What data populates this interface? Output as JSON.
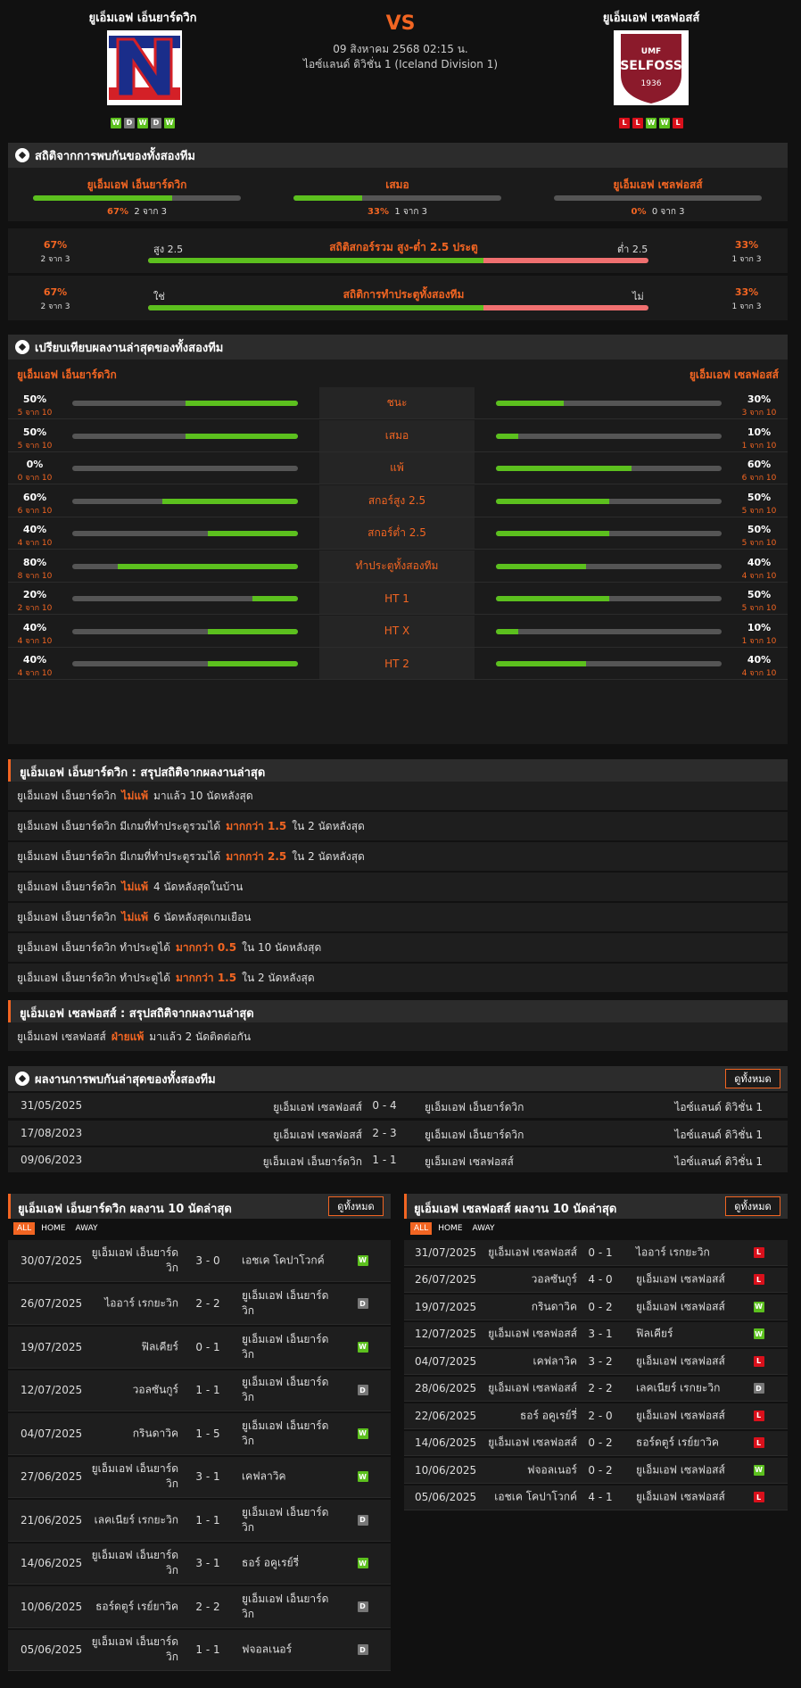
{
  "header": {
    "home_name": "ยูเอ็มเอฟ เอ็นยาร์ดวิก",
    "away_name": "ยูเอ็มเอฟ เซลฟอสส์",
    "vs": "VS",
    "datetime": "09 สิงหาคม 2568 02:15 น.",
    "league": "ไอซ์แลนด์ ดิวิชั่น 1 (Iceland Division 1)",
    "home_form": [
      "W",
      "D",
      "W",
      "D",
      "W"
    ],
    "away_form": [
      "L",
      "L",
      "W",
      "W",
      "L"
    ],
    "away_logo_text": {
      "top": "UMF",
      "main": "SELFOSS",
      "year": "1936"
    },
    "home_logo_letter": "N"
  },
  "h2h_stats": {
    "title": "สถิติจากการพบกันของทั้งสองทีม",
    "home": {
      "label": "ยูเอ็มเอฟ เอ็นยาร์ดวิก",
      "pct": "67%",
      "count": "2 จาก 3",
      "value": 0.67
    },
    "draw": {
      "label": "เสมอ",
      "pct": "33%",
      "count": "1 จาก 3",
      "value": 0.33
    },
    "away": {
      "label": "ยูเอ็มเอฟ เซลฟอสส์",
      "pct": "0%",
      "count": "0 จาก 3",
      "value": 0
    },
    "ou": {
      "left_pct": "67%",
      "left_count": "2 จาก 3",
      "left_label": "สูง 2.5",
      "title": "สถิติสกอร์รวม สูง-ต่ำ 2.5 ประตู",
      "right_label": "ต่ำ 2.5",
      "right_pct": "33%",
      "right_count": "1 จาก 3",
      "value": 0.67
    },
    "btts": {
      "left_pct": "67%",
      "left_count": "2 จาก 3",
      "left_label": "ใช่",
      "title": "สถิติการทำประตูทั้งสองทีม",
      "right_label": "ไม่",
      "right_pct": "33%",
      "right_count": "1 จาก 3",
      "value": 0.67
    }
  },
  "compare": {
    "title": "เปรียบเทียบผลงานล่าสุดของทั้งสองทีม",
    "home_label": "ยูเอ็มเอฟ เอ็นยาร์ดวิก",
    "away_label": "ยูเอ็มเอฟ เซลฟอสส์",
    "rows": [
      {
        "label": "ชนะ",
        "h_pct": "50%",
        "h_cnt": "5 จาก 10",
        "h_val": 0.5,
        "a_pct": "30%",
        "a_cnt": "3 จาก 10",
        "a_val": 0.3
      },
      {
        "label": "เสมอ",
        "h_pct": "50%",
        "h_cnt": "5 จาก 10",
        "h_val": 0.5,
        "a_pct": "10%",
        "a_cnt": "1 จาก 10",
        "a_val": 0.1
      },
      {
        "label": "แพ้",
        "h_pct": "0%",
        "h_cnt": "0 จาก 10",
        "h_val": 0,
        "a_pct": "60%",
        "a_cnt": "6 จาก 10",
        "a_val": 0.6
      },
      {
        "label": "สกอร์สูง 2.5",
        "h_pct": "60%",
        "h_cnt": "6 จาก 10",
        "h_val": 0.6,
        "a_pct": "50%",
        "a_cnt": "5 จาก 10",
        "a_val": 0.5
      },
      {
        "label": "สกอร์ต่ำ 2.5",
        "h_pct": "40%",
        "h_cnt": "4 จาก 10",
        "h_val": 0.4,
        "a_pct": "50%",
        "a_cnt": "5 จาก 10",
        "a_val": 0.5
      },
      {
        "label": "ทำประตูทั้งสองทีม",
        "h_pct": "80%",
        "h_cnt": "8 จาก 10",
        "h_val": 0.8,
        "a_pct": "40%",
        "a_cnt": "4 จาก 10",
        "a_val": 0.4
      },
      {
        "label": "HT 1",
        "h_pct": "20%",
        "h_cnt": "2 จาก 10",
        "h_val": 0.2,
        "a_pct": "50%",
        "a_cnt": "5 จาก 10",
        "a_val": 0.5
      },
      {
        "label": "HT X",
        "h_pct": "40%",
        "h_cnt": "4 จาก 10",
        "h_val": 0.4,
        "a_pct": "10%",
        "a_cnt": "1 จาก 10",
        "a_val": 0.1
      },
      {
        "label": "HT 2",
        "h_pct": "40%",
        "h_cnt": "4 จาก 10",
        "h_val": 0.4,
        "a_pct": "40%",
        "a_cnt": "4 จาก 10",
        "a_val": 0.4
      }
    ]
  },
  "home_summary": {
    "title": "ยูเอ็มเอฟ เอ็นยาร์ดวิก : สรุปสถิติจากผลงานล่าสุด",
    "rows": [
      {
        "a": "ยูเอ็มเอฟ เอ็นยาร์ดวิก",
        "h": "ไม่แพ้",
        "b": "มาแล้ว 10 นัดหลังสุด"
      },
      {
        "a": "ยูเอ็มเอฟ เอ็นยาร์ดวิก  มีเกมที่ทำประตูรวมได้",
        "h": "มากกว่า  1.5",
        "b": "ใน 2 นัดหลังสุด"
      },
      {
        "a": "ยูเอ็มเอฟ เอ็นยาร์ดวิก  มีเกมที่ทำประตูรวมได้",
        "h": "มากกว่า  2.5",
        "b": "ใน 2 นัดหลังสุด"
      },
      {
        "a": "ยูเอ็มเอฟ เอ็นยาร์ดวิก",
        "h": "ไม่แพ้",
        "b": "4  นัดหลังสุดในบ้าน"
      },
      {
        "a": "ยูเอ็มเอฟ เอ็นยาร์ดวิก",
        "h": "ไม่แพ้",
        "b": "6  นัดหลังสุดเกมเยือน"
      },
      {
        "a": "ยูเอ็มเอฟ เอ็นยาร์ดวิก  ทำประตูได้",
        "h": "มากกว่า  0.5",
        "b": "ใน 10 นัดหลังสุด"
      },
      {
        "a": "ยูเอ็มเอฟ เอ็นยาร์ดวิก  ทำประตูได้",
        "h": "มากกว่า  1.5",
        "b": "ใน 2 นัดหลังสุด"
      }
    ]
  },
  "away_summary": {
    "title": "ยูเอ็มเอฟ เซลฟอสส์ : สรุปสถิติจากผลงานล่าสุด",
    "rows": [
      {
        "a": "ยูเอ็มเอฟ เซลฟอสส์",
        "h": "ฝ่ายแพ้",
        "b": "มาแล้ว 2 นัดติดต่อกัน"
      }
    ]
  },
  "h2h_results": {
    "title": "ผลงานการพบกันล่าสุดของทั้งสองทีม",
    "button": "ดูทั้งหมด",
    "rows": [
      {
        "date": "31/05/2025",
        "home": "ยูเอ็มเอฟ เซลฟอสส์",
        "score": "0 - 4",
        "away": "ยูเอ็มเอฟ เอ็นยาร์ดวิก",
        "league": "ไอซ์แลนด์ ดิวิชั่น 1"
      },
      {
        "date": "17/08/2023",
        "home": "ยูเอ็มเอฟ เซลฟอสส์",
        "score": "2 - 3",
        "away": "ยูเอ็มเอฟ เอ็นยาร์ดวิก",
        "league": "ไอซ์แลนด์ ดิวิชั่น 1"
      },
      {
        "date": "09/06/2023",
        "home": "ยูเอ็มเอฟ เอ็นยาร์ดวิก",
        "score": "1 - 1",
        "away": "ยูเอ็มเอฟ เซลฟอสส์",
        "league": "ไอซ์แลนด์ ดิวิชั่น 1"
      }
    ]
  },
  "home_recent": {
    "title": "ยูเอ็มเอฟ เอ็นยาร์ดวิก ผลงาน 10 นัดล่าสุด",
    "button": "ดูทั้งหมด",
    "tabs": [
      "ALL",
      "HOME",
      "AWAY"
    ],
    "rows": [
      {
        "date": "30/07/2025",
        "home": "ยูเอ็มเอฟ เอ็นยาร์ด\nวิก",
        "score": "3 - 0",
        "away": "เอชเค โคปาโวกค์",
        "res": "W"
      },
      {
        "date": "26/07/2025",
        "home": "ไออาร์ เรกยะวิก",
        "score": "2 - 2",
        "away": "ยูเอ็มเอฟ เอ็นยาร์ด\nวิก",
        "res": "D"
      },
      {
        "date": "19/07/2025",
        "home": "ฟิลเคียร์",
        "score": "0 - 1",
        "away": "ยูเอ็มเอฟ เอ็นยาร์ด\nวิก",
        "res": "W"
      },
      {
        "date": "12/07/2025",
        "home": "วอลซันกูร์",
        "score": "1 - 1",
        "away": "ยูเอ็มเอฟ เอ็นยาร์ด\nวิก",
        "res": "D"
      },
      {
        "date": "04/07/2025",
        "home": "กรินดาวิค",
        "score": "1 - 5",
        "away": "ยูเอ็มเอฟ เอ็นยาร์ด\nวิก",
        "res": "W"
      },
      {
        "date": "27/06/2025",
        "home": "ยูเอ็มเอฟ เอ็นยาร์ด\nวิก",
        "score": "3 - 1",
        "away": "เคฟลาวิค",
        "res": "W"
      },
      {
        "date": "21/06/2025",
        "home": "เลคเนียร์ เรกยะวิก",
        "score": "1 - 1",
        "away": "ยูเอ็มเอฟ เอ็นยาร์ด\nวิก",
        "res": "D"
      },
      {
        "date": "14/06/2025",
        "home": "ยูเอ็มเอฟ เอ็นยาร์ด\nวิก",
        "score": "3 - 1",
        "away": "ธอร์ อคูเรย์รี่",
        "res": "W"
      },
      {
        "date": "10/06/2025",
        "home": "ธอร์ดตูร์ เรย์ยาวิค",
        "score": "2 - 2",
        "away": "ยูเอ็มเอฟ เอ็นยาร์ด\nวิก",
        "res": "D"
      },
      {
        "date": "05/06/2025",
        "home": "ยูเอ็มเอฟ เอ็นยาร์ด\nวิก",
        "score": "1 - 1",
        "away": "ฟจอลเนอร์",
        "res": "D"
      }
    ]
  },
  "away_recent": {
    "title": "ยูเอ็มเอฟ เซลฟอสส์ ผลงาน 10 นัดล่าสุด",
    "button": "ดูทั้งหมด",
    "tabs": [
      "ALL",
      "HOME",
      "AWAY"
    ],
    "rows": [
      {
        "date": "31/07/2025",
        "home": "ยูเอ็มเอฟ เซลฟอสส์",
        "score": "0 - 1",
        "away": "ไออาร์ เรกยะวิก",
        "res": "L"
      },
      {
        "date": "26/07/2025",
        "home": "วอลซันกูร์",
        "score": "4 - 0",
        "away": "ยูเอ็มเอฟ เซลฟอสส์",
        "res": "L"
      },
      {
        "date": "19/07/2025",
        "home": "กรินดาวิค",
        "score": "0 - 2",
        "away": "ยูเอ็มเอฟ เซลฟอสส์",
        "res": "W"
      },
      {
        "date": "12/07/2025",
        "home": "ยูเอ็มเอฟ เซลฟอสส์",
        "score": "3 - 1",
        "away": "ฟิลเคียร์",
        "res": "W"
      },
      {
        "date": "04/07/2025",
        "home": "เคฟลาวิค",
        "score": "3 - 2",
        "away": "ยูเอ็มเอฟ เซลฟอสส์",
        "res": "L"
      },
      {
        "date": "28/06/2025",
        "home": "ยูเอ็มเอฟ เซลฟอสส์",
        "score": "2 - 2",
        "away": "เลคเนียร์ เรกยะวิก",
        "res": "D"
      },
      {
        "date": "22/06/2025",
        "home": "ธอร์ อคูเรย์รี่",
        "score": "2 - 0",
        "away": "ยูเอ็มเอฟ เซลฟอสส์",
        "res": "L"
      },
      {
        "date": "14/06/2025",
        "home": "ยูเอ็มเอฟ เซลฟอสส์",
        "score": "0 - 2",
        "away": "ธอร์ดตูร์ เรย์ยาวิค",
        "res": "L"
      },
      {
        "date": "10/06/2025",
        "home": "ฟจอลเนอร์",
        "score": "0 - 2",
        "away": "ยูเอ็มเอฟ เซลฟอสส์",
        "res": "W"
      },
      {
        "date": "05/06/2025",
        "home": "เอชเค โคปาโวกค์",
        "score": "4 - 1",
        "away": "ยูเอ็มเอฟ เซลฟอสส์",
        "res": "L"
      }
    ]
  },
  "colors": {
    "accent": "#f26522",
    "win": "#5cc01e",
    "draw": "#777777",
    "loss": "#d9101b",
    "bar_track": "#555555",
    "under_bar": "#f07070"
  }
}
